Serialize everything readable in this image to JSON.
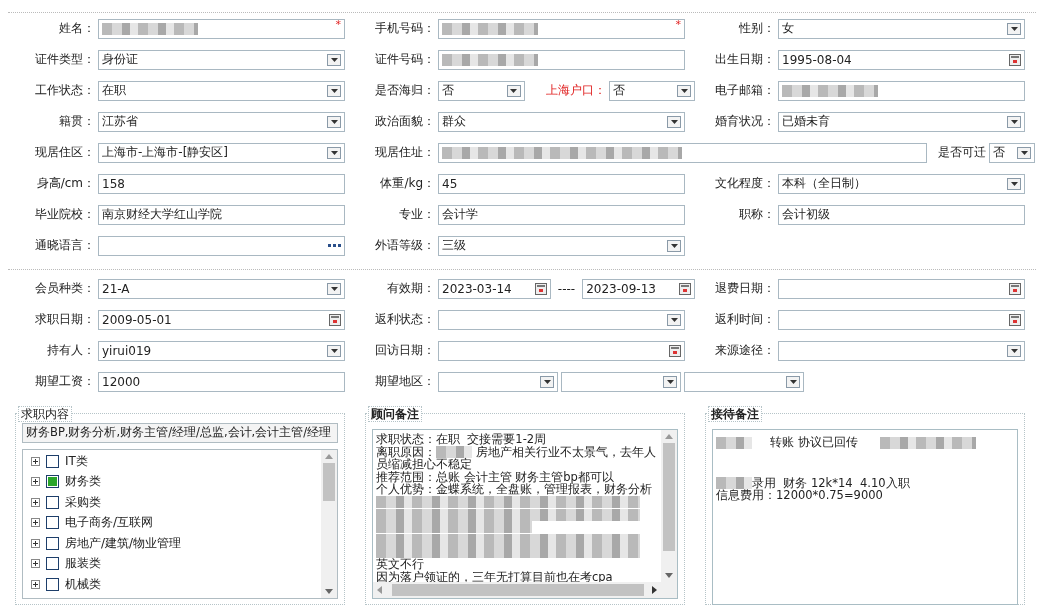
{
  "section_1": {
    "rows": [
      [
        {
          "items": [
            {
              "kind": "label",
              "text": "姓名："
            },
            {
              "kind": "text",
              "redacted": true,
              "mark": "*"
            }
          ]
        },
        {
          "items": [
            {
              "kind": "label",
              "text": "手机号码："
            },
            {
              "kind": "text",
              "redacted": true,
              "mark": "*"
            }
          ]
        },
        {
          "items": [
            {
              "kind": "label",
              "text": "性别："
            },
            {
              "kind": "select",
              "value": "女"
            }
          ]
        }
      ],
      [
        {
          "items": [
            {
              "kind": "label",
              "text": "证件类型："
            },
            {
              "kind": "select",
              "value": "身份证"
            }
          ]
        },
        {
          "items": [
            {
              "kind": "label",
              "text": "证件号码："
            },
            {
              "kind": "text",
              "redacted": true
            }
          ]
        },
        {
          "items": [
            {
              "kind": "label",
              "text": "出生日期："
            },
            {
              "kind": "date",
              "value": "1995-08-04"
            }
          ]
        }
      ],
      [
        {
          "items": [
            {
              "kind": "label",
              "text": "工作状态："
            },
            {
              "kind": "select",
              "value": "在职"
            }
          ]
        },
        {
          "items": [
            {
              "kind": "label",
              "text": "是否海归："
            },
            {
              "kind": "select",
              "value": "否"
            },
            {
              "kind": "label",
              "text": "上海户口：",
              "emphasis": true
            },
            {
              "kind": "select",
              "value": "否"
            }
          ]
        },
        {
          "items": [
            {
              "kind": "label",
              "text": "电子邮箱："
            },
            {
              "kind": "text",
              "redacted": true
            }
          ]
        }
      ],
      [
        {
          "items": [
            {
              "kind": "label",
              "text": "籍贯："
            },
            {
              "kind": "select",
              "value": "江苏省"
            }
          ]
        },
        {
          "items": [
            {
              "kind": "label",
              "text": "政治面貌："
            },
            {
              "kind": "select",
              "value": "群众"
            }
          ]
        },
        {
          "items": [
            {
              "kind": "label",
              "text": "婚育状况："
            },
            {
              "kind": "select",
              "value": "已婚未育"
            }
          ]
        }
      ],
      [
        {
          "items": [
            {
              "kind": "label",
              "text": "现居住区："
            },
            {
              "kind": "select",
              "value": "上海市-上海市-[静安区]"
            }
          ]
        },
        {
          "wide": true,
          "items": [
            {
              "kind": "label",
              "text": "现居住址："
            },
            {
              "kind": "text",
              "redacted": true
            },
            {
              "kind": "label",
              "text": "是否可迁"
            },
            {
              "kind": "select",
              "value": "否"
            }
          ]
        }
      ],
      [
        {
          "items": [
            {
              "kind": "label",
              "text": "身高/cm："
            },
            {
              "kind": "text",
              "value": "158"
            }
          ]
        },
        {
          "items": [
            {
              "kind": "label",
              "text": "体重/kg："
            },
            {
              "kind": "text",
              "value": "45"
            }
          ]
        },
        {
          "items": [
            {
              "kind": "label",
              "text": "文化程度："
            },
            {
              "kind": "select",
              "value": "本科（全日制）"
            }
          ]
        }
      ],
      [
        {
          "items": [
            {
              "kind": "label",
              "text": "毕业院校："
            },
            {
              "kind": "text",
              "value": "南京财经大学红山学院"
            }
          ]
        },
        {
          "items": [
            {
              "kind": "label",
              "text": "专业："
            },
            {
              "kind": "text",
              "value": "会计学"
            }
          ]
        },
        {
          "items": [
            {
              "kind": "label",
              "text": "职称："
            },
            {
              "kind": "text",
              "value": "会计初级"
            }
          ]
        }
      ],
      [
        {
          "items": [
            {
              "kind": "label",
              "text": "通晓语言："
            },
            {
              "kind": "picker"
            }
          ]
        },
        {
          "items": [
            {
              "kind": "label",
              "text": "外语等级："
            },
            {
              "kind": "select",
              "value": "三级"
            }
          ]
        }
      ]
    ]
  },
  "section_2": {
    "rows": [
      [
        {
          "items": [
            {
              "kind": "label",
              "text": "会员种类："
            },
            {
              "kind": "select",
              "value": "21-A"
            }
          ]
        },
        {
          "items": [
            {
              "kind": "label",
              "text": "有效期："
            },
            {
              "kind": "date",
              "value": "2023-03-14"
            },
            {
              "kind": "sep",
              "text": "----"
            },
            {
              "kind": "date",
              "value": "2023-09-13"
            }
          ]
        },
        {
          "items": [
            {
              "kind": "label",
              "text": "退费日期："
            },
            {
              "kind": "date"
            }
          ]
        }
      ],
      [
        {
          "items": [
            {
              "kind": "label",
              "text": "求职日期："
            },
            {
              "kind": "date",
              "value": "2009-05-01"
            }
          ]
        },
        {
          "items": [
            {
              "kind": "label",
              "text": "返利状态："
            },
            {
              "kind": "select"
            }
          ]
        },
        {
          "items": [
            {
              "kind": "label",
              "text": "返利时间："
            },
            {
              "kind": "date"
            }
          ]
        }
      ],
      [
        {
          "items": [
            {
              "kind": "label",
              "text": "持有人："
            },
            {
              "kind": "select",
              "value": "yirui019"
            }
          ]
        },
        {
          "items": [
            {
              "kind": "label",
              "text": "回访日期："
            },
            {
              "kind": "date"
            }
          ]
        },
        {
          "items": [
            {
              "kind": "label",
              "text": "来源途径："
            },
            {
              "kind": "select"
            }
          ]
        }
      ],
      [
        {
          "items": [
            {
              "kind": "label",
              "text": "期望工资："
            },
            {
              "kind": "text",
              "value": "12000"
            }
          ]
        },
        {
          "wide": true,
          "items": [
            {
              "kind": "label",
              "text": "期望地区："
            },
            {
              "kind": "select"
            },
            {
              "kind": "select"
            },
            {
              "kind": "select"
            }
          ]
        }
      ]
    ]
  },
  "job_content": {
    "legend": "求职内容",
    "summary": "财务BP,财务分析,财务主管/经理/总监,会计,会计主管/经理",
    "tree": [
      {
        "label": "IT类",
        "checked": false
      },
      {
        "label": "财务类",
        "checked": true
      },
      {
        "label": "采购类",
        "checked": false
      },
      {
        "label": "电子商务/互联网",
        "checked": false
      },
      {
        "label": "房地产/建筑/物业管理",
        "checked": false
      },
      {
        "label": "服装类",
        "checked": false
      },
      {
        "label": "机械类",
        "checked": false
      }
    ]
  },
  "consultant_notes": {
    "legend": "顾问备注",
    "lines": [
      [
        {
          "kind": "text",
          "text": "求职状态：在职  交接需要1-2周"
        }
      ],
      [
        {
          "kind": "text",
          "text": "离职原因："
        },
        {
          "kind": "blur"
        },
        {
          "kind": "text",
          "text": " 房地产相关行业不太景气，去年人"
        }
      ],
      [
        {
          "kind": "text",
          "text": "员缩减担心不稳定"
        }
      ],
      [
        {
          "kind": "text",
          "text": "推荐范围：总账 会计主管 财务主管bp都可以"
        }
      ],
      [
        {
          "kind": "text",
          "text": "个人优势：金蝶系统，全盘账，管理报表，财务分析"
        }
      ],
      [
        {
          "kind": "blur"
        }
      ],
      [
        {
          "kind": "blur"
        }
      ],
      [
        {
          "kind": "blur"
        }
      ],
      [
        {
          "kind": "blur"
        }
      ],
      [
        {
          "kind": "blur"
        }
      ],
      [
        {
          "kind": "text",
          "text": "英文不行"
        }
      ],
      [
        {
          "kind": "text",
          "text": "因为落户领证的，三年无打算目前也在考cpa"
        }
      ]
    ]
  },
  "reception_notes": {
    "legend": "接待备注",
    "paragraphs": [
      [
        [
          {
            "kind": "blur"
          },
          {
            "kind": "text",
            "text": "     转账 协议已回传      "
          },
          {
            "kind": "blur"
          }
        ]
      ],
      [
        [
          {
            "kind": "blur"
          },
          {
            "kind": "text",
            "text": "录用  财务 12k*14  4.10入职"
          }
        ],
        [
          {
            "kind": "text",
            "text": "信息费用：12000*0.75=9000"
          }
        ]
      ]
    ]
  }
}
